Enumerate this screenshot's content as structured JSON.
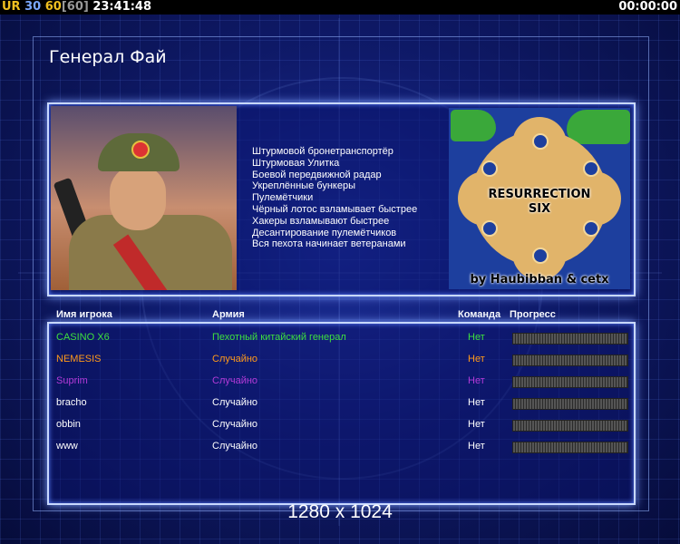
{
  "topbar": {
    "ur": "UR",
    "fps_a": "30",
    "fps_b": "60",
    "fps_c": "[60]",
    "clock": "23:41:48",
    "timer": "00:00:00"
  },
  "title": "Генерал Фай",
  "features": [
    "Штурмовой бронетранспортёр",
    "Штурмовая Улитка",
    "Боевой передвижной радар",
    "Укреплённые бункеры",
    "Пулемётчики",
    "Чёрный лотос взламывает быстрее",
    "Хакеры взламывают быстрее",
    "Десантирование пулемётчиков",
    "Вся пехота начинает ветеранами"
  ],
  "map": {
    "title_line1": "RESURRECTION",
    "title_line2": "SIX",
    "credit": "by Haubibban & cetx"
  },
  "headers": {
    "player": "Имя игрока",
    "army": "Армия",
    "team": "Команда",
    "progress": "Прогресс"
  },
  "players": [
    {
      "name": "CASINO X6",
      "army": "Пехотный китайский генерал",
      "team": "Нет",
      "color": "#3ee03e"
    },
    {
      "name": "NEMESIS",
      "army": "Случайно",
      "team": "Нет",
      "color": "#ff9a1a"
    },
    {
      "name": "Suprim",
      "army": "Случайно",
      "team": "Нет",
      "color": "#b43ad8"
    },
    {
      "name": "bracho",
      "army": "Случайно",
      "team": "Нет",
      "color": "#ffffff"
    },
    {
      "name": "obbin",
      "army": "Случайно",
      "team": "Нет",
      "color": "#ffffff"
    },
    {
      "name": "www",
      "army": "Случайно",
      "team": "Нет",
      "color": "#ffffff"
    }
  ],
  "resolution": "1280 x 1024"
}
